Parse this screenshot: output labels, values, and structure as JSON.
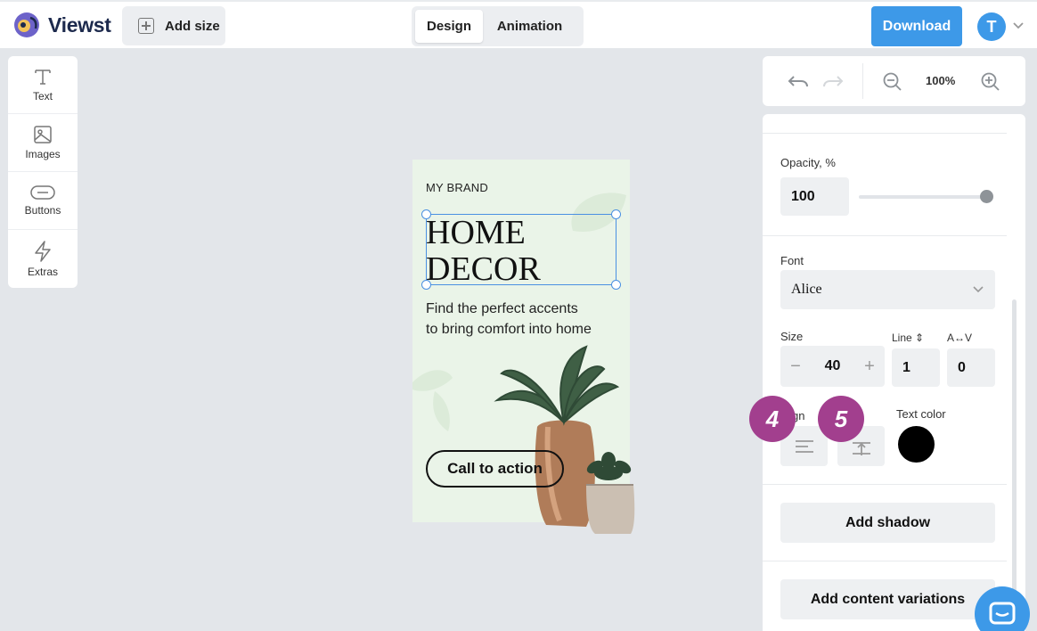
{
  "header": {
    "logo_text": "Viewst",
    "add_size_label": "Add size",
    "tabs": [
      {
        "label": "Design",
        "active": true
      },
      {
        "label": "Animation",
        "active": false
      }
    ],
    "download_label": "Download",
    "avatar_initial": "T"
  },
  "tools": [
    {
      "label": "Text",
      "icon": "text-icon"
    },
    {
      "label": "Images",
      "icon": "image-icon"
    },
    {
      "label": "Buttons",
      "icon": "button-icon"
    },
    {
      "label": "Extras",
      "icon": "lightning-icon"
    }
  ],
  "canvas": {
    "brand": "MY BRAND",
    "headline_line1": "HOME",
    "headline_line2": "DECOR",
    "subtext_line1": "Find the perfect accents",
    "subtext_line2": "to bring comfort into home",
    "cta_label": "Call to action",
    "background_color": "#eaf4e8"
  },
  "zoom": {
    "value": "100%"
  },
  "properties": {
    "opacity_label": "Opacity, %",
    "opacity_value": "100",
    "opacity_level": 1.0,
    "font_label": "Font",
    "font_value": "Alice",
    "size_label": "Size",
    "size_value": "40",
    "line_label": "Line ⇕",
    "line_value": "1",
    "spacing_label": "A↔V",
    "spacing_value": "0",
    "align_label": "gn",
    "text_color_label": "Text color",
    "text_color": "#000000",
    "add_shadow_label": "Add shadow",
    "add_variations_label": "Add content variations"
  },
  "badges": [
    "4",
    "5"
  ],
  "colors": {
    "accent": "#3d99e8",
    "badge": "#a23f8e"
  }
}
